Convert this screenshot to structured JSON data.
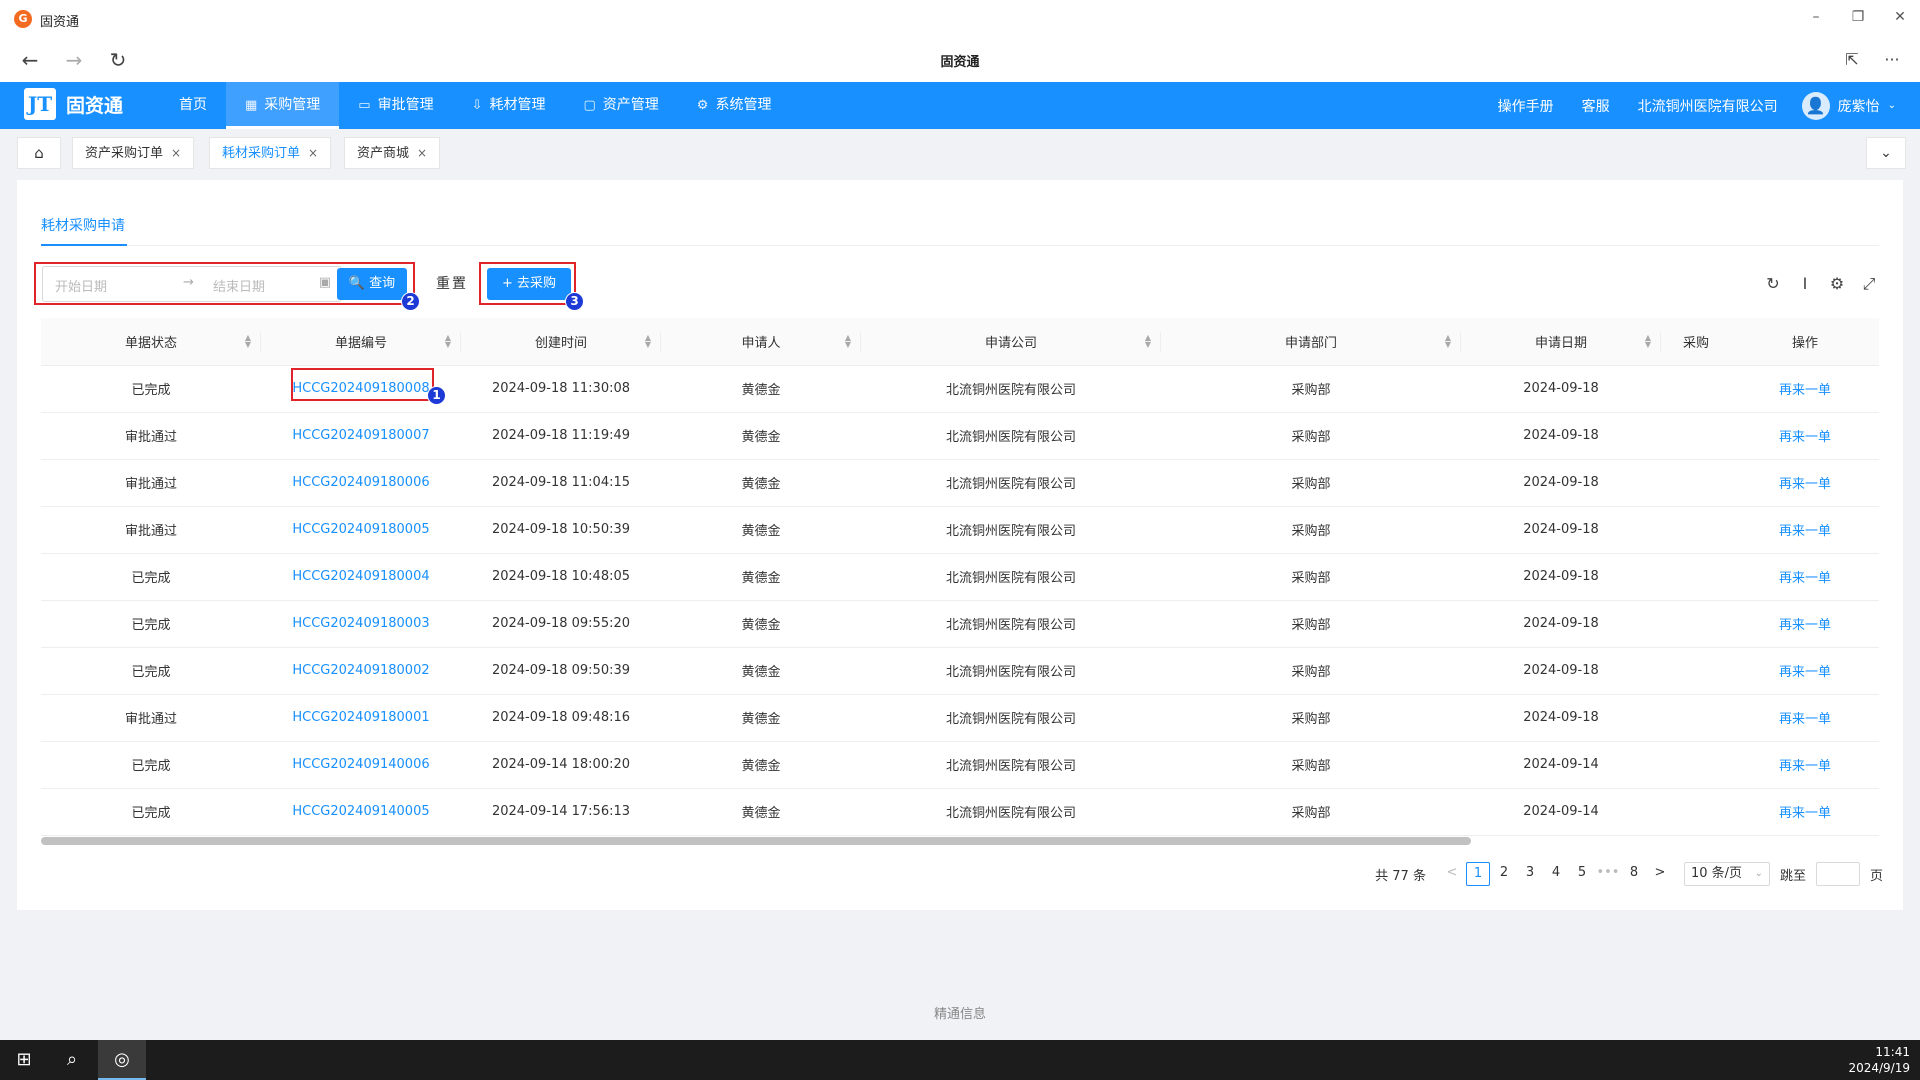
{
  "window": {
    "title": "固资通",
    "logo_text": "G",
    "minimize": "–",
    "restore": "❐",
    "close": "✕"
  },
  "browser": {
    "title": "固资通",
    "back": "←",
    "forward": "→",
    "reload": "↻",
    "share": "⇱",
    "more": "···"
  },
  "header": {
    "brand_mark": "JT",
    "brand": "固资通",
    "menu": [
      {
        "label": "首页",
        "icon": ""
      },
      {
        "label": "采购管理",
        "icon": "▦"
      },
      {
        "label": "审批管理",
        "icon": "▭"
      },
      {
        "label": "耗材管理",
        "icon": "⇩"
      },
      {
        "label": "资产管理",
        "icon": "▢"
      },
      {
        "label": "系统管理",
        "icon": "⚙"
      }
    ],
    "manual": "操作手册",
    "service": "客服",
    "company": "北流铜州医院有限公司",
    "user": "庞紫怡",
    "avatar_glyph": "👤",
    "chevron": "⌄"
  },
  "tabs": {
    "home_glyph": "⌂",
    "items": [
      {
        "label": "资产采购订单"
      },
      {
        "label": "耗材采购订单"
      },
      {
        "label": "资产商城"
      }
    ],
    "close_glyph": "×",
    "collapse_glyph": "⌄"
  },
  "page": {
    "subtab": "耗材采购申请",
    "date_start_placeholder": "开始日期",
    "date_arrow": "→",
    "date_end_placeholder": "结束日期",
    "calendar_glyph": "▣",
    "query": "🔍 查询",
    "reset": "重置",
    "buy": "+ 去采购",
    "badges": [
      "1",
      "2",
      "3"
    ],
    "tools": {
      "refresh": "↻",
      "density": "Ⅰ",
      "settings": "⚙",
      "fullscreen": "⤢"
    }
  },
  "table": {
    "columns": [
      "单据状态",
      "单据编号",
      "创建时间",
      "申请人",
      "申请公司",
      "申请部门",
      "申请日期",
      "采购",
      "操作"
    ],
    "sort_glyph_up": "▲",
    "sort_glyph_down": "▼",
    "rows": [
      {
        "status": "已完成",
        "no": "HCCG202409180008",
        "created": "2024-09-18 11:30:08",
        "applicant": "黄德金",
        "company": "北流铜州医院有限公司",
        "dept": "采购部",
        "date": "2024-09-18",
        "op": "再来一单"
      },
      {
        "status": "审批通过",
        "no": "HCCG202409180007",
        "created": "2024-09-18 11:19:49",
        "applicant": "黄德金",
        "company": "北流铜州医院有限公司",
        "dept": "采购部",
        "date": "2024-09-18",
        "op": "再来一单"
      },
      {
        "status": "审批通过",
        "no": "HCCG202409180006",
        "created": "2024-09-18 11:04:15",
        "applicant": "黄德金",
        "company": "北流铜州医院有限公司",
        "dept": "采购部",
        "date": "2024-09-18",
        "op": "再来一单"
      },
      {
        "status": "审批通过",
        "no": "HCCG202409180005",
        "created": "2024-09-18 10:50:39",
        "applicant": "黄德金",
        "company": "北流铜州医院有限公司",
        "dept": "采购部",
        "date": "2024-09-18",
        "op": "再来一单"
      },
      {
        "status": "已完成",
        "no": "HCCG202409180004",
        "created": "2024-09-18 10:48:05",
        "applicant": "黄德金",
        "company": "北流铜州医院有限公司",
        "dept": "采购部",
        "date": "2024-09-18",
        "op": "再来一单"
      },
      {
        "status": "已完成",
        "no": "HCCG202409180003",
        "created": "2024-09-18 09:55:20",
        "applicant": "黄德金",
        "company": "北流铜州医院有限公司",
        "dept": "采购部",
        "date": "2024-09-18",
        "op": "再来一单"
      },
      {
        "status": "已完成",
        "no": "HCCG202409180002",
        "created": "2024-09-18 09:50:39",
        "applicant": "黄德金",
        "company": "北流铜州医院有限公司",
        "dept": "采购部",
        "date": "2024-09-18",
        "op": "再来一单"
      },
      {
        "status": "审批通过",
        "no": "HCCG202409180001",
        "created": "2024-09-18 09:48:16",
        "applicant": "黄德金",
        "company": "北流铜州医院有限公司",
        "dept": "采购部",
        "date": "2024-09-18",
        "op": "再来一单"
      },
      {
        "status": "已完成",
        "no": "HCCG202409140006",
        "created": "2024-09-14 18:00:20",
        "applicant": "黄德金",
        "company": "北流铜州医院有限公司",
        "dept": "采购部",
        "date": "2024-09-14",
        "op": "再来一单"
      },
      {
        "status": "已完成",
        "no": "HCCG202409140005",
        "created": "2024-09-14 17:56:13",
        "applicant": "黄德金",
        "company": "北流铜州医院有限公司",
        "dept": "采购部",
        "date": "2024-09-14",
        "op": "再来一单"
      }
    ]
  },
  "pagination": {
    "total": "共 77 条",
    "prev": "<",
    "pages": [
      "1",
      "2",
      "3",
      "4",
      "5"
    ],
    "ellipsis": "•••",
    "last": "8",
    "next": ">",
    "size": "10 条/页",
    "size_chevron": "⌄",
    "jump": "跳至",
    "page_suffix": "页"
  },
  "footer": "精通信息",
  "taskbar": {
    "start": "⊞",
    "search": "⌕",
    "app": "◎",
    "time": "11:41",
    "date": "2024/9/19"
  },
  "colors": {
    "primary": "#1890ff",
    "highlight": "#e0242a",
    "badge": "#1e3ad6"
  }
}
